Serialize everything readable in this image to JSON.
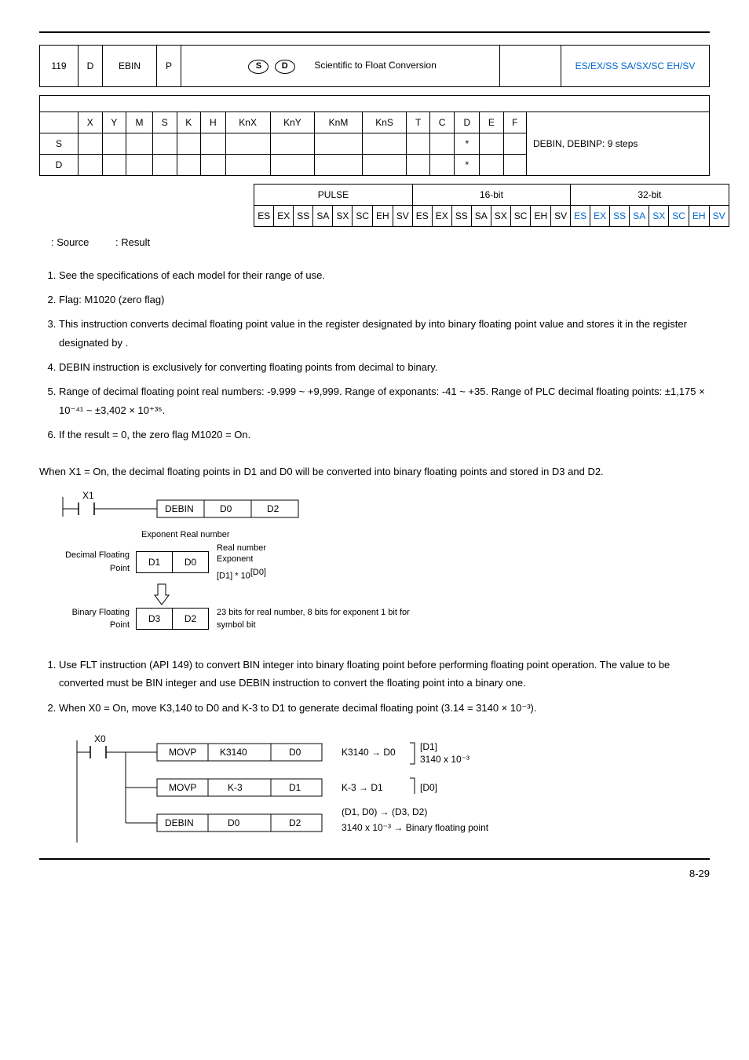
{
  "header": {
    "api": "119",
    "d": "D",
    "mnemonic": "EBIN",
    "p": "P",
    "s_letter": "S",
    "d_letter": "D",
    "function": "Scientific to Float Conversion",
    "controllers": "ES/EX/SS SA/SX/SC EH/SV"
  },
  "bit_headers": [
    "X",
    "Y",
    "M",
    "S",
    "K",
    "H",
    "KnX",
    "KnY",
    "KnM",
    "KnS",
    "T",
    "C",
    "D",
    "E",
    "F"
  ],
  "operand_rows": {
    "s_label": "S",
    "d_label": "D",
    "s_star_col": 12,
    "d_star_col": 12
  },
  "steps_text": "DEBIN, DEBINP: 9 steps",
  "pulse_table": {
    "pulse": "PULSE",
    "bit16": "16-bit",
    "bit32": "32-bit",
    "cols1": [
      "ES",
      "EX",
      "SS",
      "SA",
      "SX",
      "SC",
      "EH",
      "SV"
    ],
    "cols2": [
      "ES",
      "EX",
      "SS",
      "SA",
      "SX",
      "SC",
      "EH",
      "SV"
    ],
    "cols3": [
      "ES",
      "EX",
      "SS",
      "SA",
      "SX",
      "SC",
      "EH",
      "SV"
    ]
  },
  "source_result": {
    "source": ": Source",
    "result": ": Result"
  },
  "explanations": [
    "See the specifications of each model for their range of use.",
    "Flag: M1020 (zero flag)",
    "This instruction converts decimal floating point value in the register designated by    into binary floating point value and stores it in the register designated by   .",
    "DEBIN instruction is exclusively for converting floating points from decimal to binary.",
    "Range of decimal floating point real numbers: -9.999 ~ +9,999. Range of exponants: -41 ~ +35. Range of PLC decimal floating points: ±1,175 × 10⁻⁴¹ ~ ±3,402 × 10⁺³⁵.",
    "If the result = 0, the zero flag M1020 = On."
  ],
  "program_intro": "When X1 = On, the decimal floating points in D1 and D0 will be converted into binary floating points and stored in D3 and D2.",
  "ladder1": {
    "contact": "X1",
    "cells": [
      "DEBIN",
      "D0",
      "D2"
    ]
  },
  "diagram": {
    "exp_real": "Exponent  Real number",
    "real_number": "Real number",
    "exponent_word": "Exponent",
    "d1d0_formula": "[D1] * 10",
    "d0_sup": "[D0]",
    "dec_fp": "Decimal Floating Point",
    "bin_fp": "Binary Floating Point",
    "d1": "D1",
    "d0": "D0",
    "d3": "D3",
    "d2": "D2",
    "bits_text": "23 bits for real number, 8 bits for exponent 1 bit for symbol bit"
  },
  "remarks": [
    "Use FLT instruction (API 149) to convert BIN integer into binary floating point before performing floating point operation. The value to be converted must be BIN integer and use DEBIN instruction to convert the floating point into a binary one.",
    "When X0 = On, move K3,140 to D0 and K-3 to D1 to generate decimal floating point (3.14 = 3140 × 10⁻³)."
  ],
  "ladder2": {
    "contact": "X0",
    "row1": [
      "MOVP",
      "K3140",
      "D0"
    ],
    "row2": [
      "MOVP",
      "K-3",
      "D1"
    ],
    "row3": [
      "DEBIN",
      "D0",
      "D2"
    ],
    "ann1a": "K3140 → D0",
    "ann1b": "[D1]",
    "ann1c": "3140 x 10⁻³",
    "ann2a": "K-3  →  D1",
    "ann2b": "[D0]",
    "ann3a": "(D1, D0)  →  (D3, D2)",
    "ann3b": "3140 x 10⁻³ → Binary floating point"
  },
  "page": "8-29"
}
